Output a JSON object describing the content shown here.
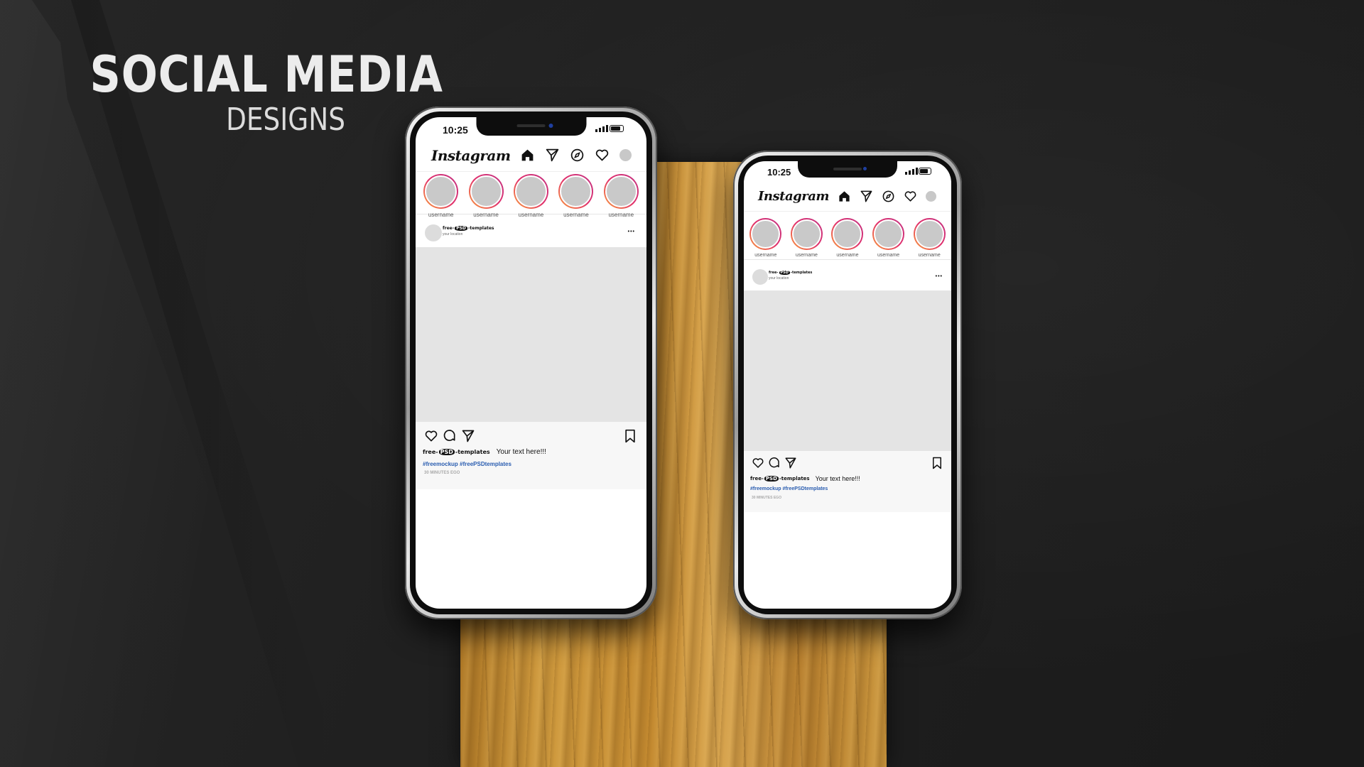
{
  "heading": {
    "line1": "SOCIAL MEDIA",
    "line2": "DESIGNS"
  },
  "phones": [
    {
      "status_time": "10:25",
      "app_logo": "Instagram",
      "nav_icons": [
        "home-icon",
        "send-icon",
        "explore-icon",
        "heart-icon",
        "profile-avatar"
      ],
      "stories": [
        "username",
        "username",
        "username",
        "username",
        "username"
      ],
      "post": {
        "brand_prefix": "free-",
        "brand_psd": "PSD",
        "brand_suffix": "-templates",
        "location": "your location",
        "menu": "•••",
        "caption_text": "Your text here!!!",
        "hashtags": "#freemockup #freePSDtemplates",
        "time_ago": "30 MINUTES EGO"
      }
    },
    {
      "status_time": "10:25",
      "app_logo": "Instagram",
      "nav_icons": [
        "home-icon",
        "send-icon",
        "explore-icon",
        "heart-icon",
        "profile-avatar"
      ],
      "stories": [
        "username",
        "username",
        "username",
        "username",
        "username"
      ],
      "post": {
        "brand_prefix": "free-",
        "brand_psd": "PSD",
        "brand_suffix": "-templates",
        "location": "your location",
        "menu": "•••",
        "caption_text": "Your text here!!!",
        "hashtags": "#freemockup #freePSDtemplates",
        "time_ago": "30 MINUTES EGO"
      }
    }
  ],
  "colors": {
    "background": "#1c1c1c",
    "wood": "#c48a30",
    "story_ring": "#e1306c",
    "hashtag": "#2a5db0"
  }
}
